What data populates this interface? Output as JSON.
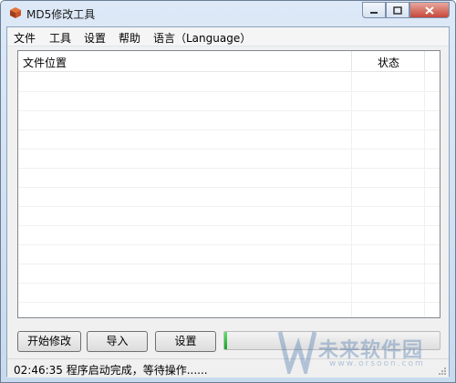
{
  "window": {
    "title": "MD5修改工具"
  },
  "menu": {
    "items": [
      "文件",
      "工具",
      "设置",
      "帮助",
      "语言（Language）"
    ]
  },
  "list": {
    "columns": [
      "文件位置",
      "状态"
    ],
    "rows": []
  },
  "buttons": {
    "start": "开始修改",
    "import": "导入",
    "settings": "设置"
  },
  "progress": {
    "value": 0.01,
    "color": "#22b333"
  },
  "status": {
    "text": "02:46:35 程序启动完成，等待操作......"
  },
  "watermark": {
    "brand": "未来软件园",
    "domain": "www.orsoon.com"
  }
}
